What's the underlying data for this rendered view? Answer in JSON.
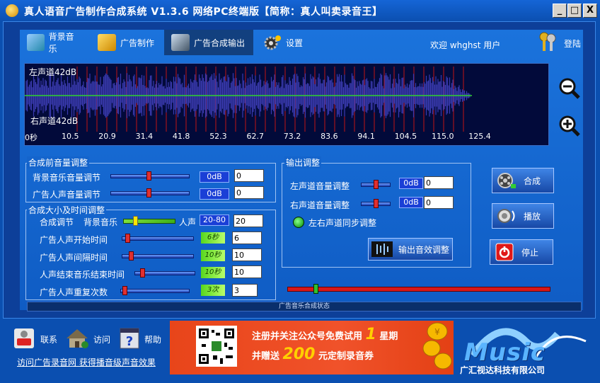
{
  "window": {
    "title": "真人语音广告制作合成系统 V1.3.6 网络PC终端版【简称：真人叫卖录音王】",
    "min_btn": "_",
    "restore_btn": "□",
    "close_btn": "X"
  },
  "tabs": [
    {
      "label": "背景音乐"
    },
    {
      "label": "广告制作"
    },
    {
      "label": "广告合成输出"
    },
    {
      "label": "设置"
    }
  ],
  "header": {
    "welcome": "欢迎 whghst 用户",
    "login": "登陆"
  },
  "waveform": {
    "left_label": "左声道42dB",
    "right_label": "右声道42dB",
    "ticks": [
      "0秒",
      "10.5",
      "20.9",
      "31.4",
      "41.8",
      "52.3",
      "62.7",
      "73.2",
      "83.6",
      "94.1",
      "104.5",
      "115.0",
      "125.4"
    ],
    "wave_color": "#3a3ab0",
    "line_color": "#2ed12e",
    "marker_color": "#c01414"
  },
  "pre_volume": {
    "legend": "合成前音量调整",
    "rows": [
      {
        "label": "背景音乐音量调节",
        "badge": "0dB",
        "value": "0",
        "level": 0.5
      },
      {
        "label": "广告人声音量调节",
        "badge": "0dB",
        "value": "0",
        "level": 0.5
      }
    ]
  },
  "size_time": {
    "legend": "合成大小及时间调整",
    "mix": {
      "label": "合成调节",
      "left": "背景音乐",
      "right": "人声",
      "badge": "20-80",
      "value": "20"
    },
    "rows": [
      {
        "label": "广告人声开始时间",
        "badge": "6秒",
        "value": "6",
        "level": 0.05
      },
      {
        "label": "广告人声间隔时间",
        "badge": "10秒",
        "value": "10",
        "level": 0.1
      },
      {
        "label": "人声结束音乐结束时间",
        "badge": "10秒",
        "value": "10",
        "level": 0.1
      },
      {
        "label": "广告人声重复次数",
        "badge": "3次",
        "value": "3",
        "level": 0.03
      }
    ]
  },
  "output": {
    "legend": "输出调整",
    "rows": [
      {
        "label": "左声道音量调整",
        "badge": "0dB",
        "value": "0",
        "level": 0.5
      },
      {
        "label": "右声道音量调整",
        "badge": "0dB",
        "value": "0",
        "level": 0.5
      }
    ],
    "sync_label": "左右声道同步调整",
    "effect_button": "输出音效调整"
  },
  "actions": {
    "compose": "合成",
    "play": "播放",
    "stop": "停止"
  },
  "progress": {
    "position": 0.1
  },
  "status": {
    "text": "广告音乐合成状态"
  },
  "footer": {
    "contact": "联系",
    "visit": "访问",
    "help": "帮助",
    "link": "访问广告录音网 获得播音级声音效果"
  },
  "banner": {
    "line1_pre": "注册并关注公众号免费试用",
    "line1_num": "1",
    "line1_post": "星期",
    "line2_pre": "并赠送",
    "line2_num": "200",
    "line2_post": "元定制录音券"
  },
  "logo": {
    "word": "Music",
    "company": "广汇视达科技有限公司"
  }
}
